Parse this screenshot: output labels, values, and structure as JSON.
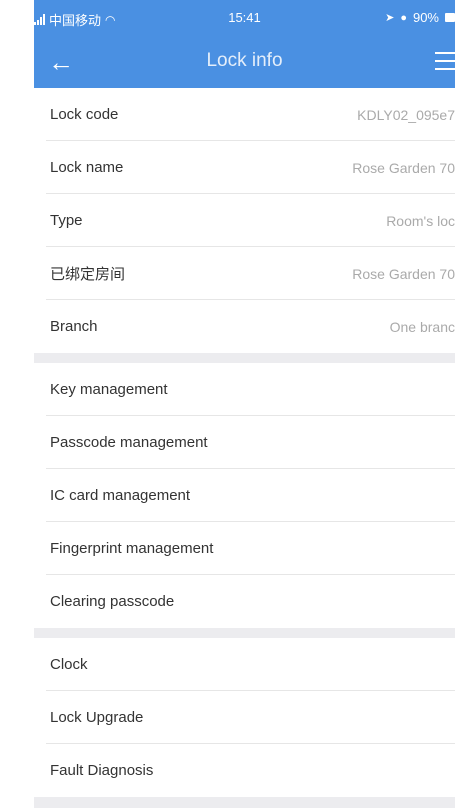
{
  "status_bar": {
    "carrier": "中国移动",
    "time": "15:41",
    "battery": "90%"
  },
  "navbar": {
    "title": "Lock info"
  },
  "info_group": [
    {
      "label": "Lock code",
      "value": "KDLY02_095e7"
    },
    {
      "label": "Lock name",
      "value": "Rose Garden 70"
    },
    {
      "label": "Type",
      "value": "Room's loc"
    },
    {
      "label": "已绑定房间",
      "value": "Rose Garden 70"
    },
    {
      "label": "Branch",
      "value": "One branc"
    }
  ],
  "management_group": [
    {
      "label": "Key management"
    },
    {
      "label": "Passcode management"
    },
    {
      "label": "IC card management"
    },
    {
      "label": "Fingerprint management"
    },
    {
      "label": "Clearing passcode"
    }
  ],
  "system_group": [
    {
      "label": "Clock"
    },
    {
      "label": "Lock Upgrade"
    },
    {
      "label": "Fault Diagnosis"
    }
  ],
  "colors": {
    "accent": "#4a90e2",
    "background": "#f2f2f4"
  }
}
